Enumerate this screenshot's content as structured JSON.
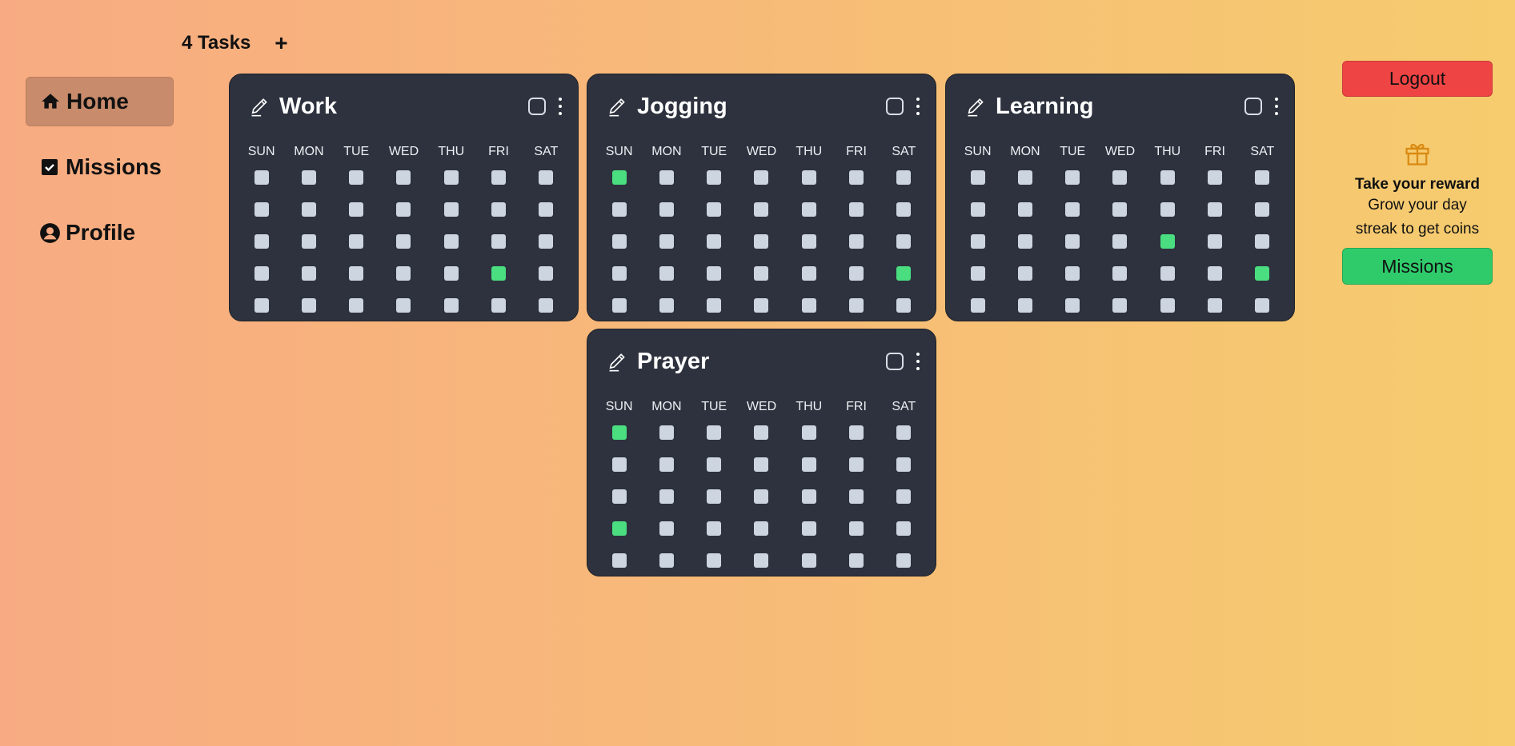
{
  "sidebar": {
    "items": [
      {
        "label": "Home",
        "icon": "home-icon",
        "active": true
      },
      {
        "label": "Missions",
        "icon": "check-square-icon",
        "active": false
      },
      {
        "label": "Profile",
        "icon": "user-circle-icon",
        "active": false
      }
    ]
  },
  "header": {
    "tasks_label": "4 Tasks",
    "add_label": "+"
  },
  "days": [
    "SUN",
    "MON",
    "TUE",
    "WED",
    "THU",
    "FRI",
    "SAT"
  ],
  "tasks": [
    {
      "title": "Work",
      "checked_cells": [
        [
          3,
          5
        ]
      ]
    },
    {
      "title": "Jogging",
      "checked_cells": [
        [
          0,
          0
        ],
        [
          3,
          6
        ]
      ]
    },
    {
      "title": "Learning",
      "checked_cells": [
        [
          2,
          4
        ],
        [
          3,
          6
        ]
      ]
    },
    {
      "title": "Prayer",
      "checked_cells": [
        [
          0,
          0
        ],
        [
          3,
          0
        ]
      ]
    }
  ],
  "rows_per_task": 5,
  "right": {
    "logout_label": "Logout",
    "reward_title": "Take your reward",
    "reward_line1": "Grow your day",
    "reward_line2": "streak to get coins",
    "missions_label": "Missions",
    "gift_icon": "gift-icon"
  },
  "colors": {
    "done": "#4ade80",
    "logout": "#ef4444",
    "missions": "#2fcb6b",
    "card": "#2d323e"
  }
}
